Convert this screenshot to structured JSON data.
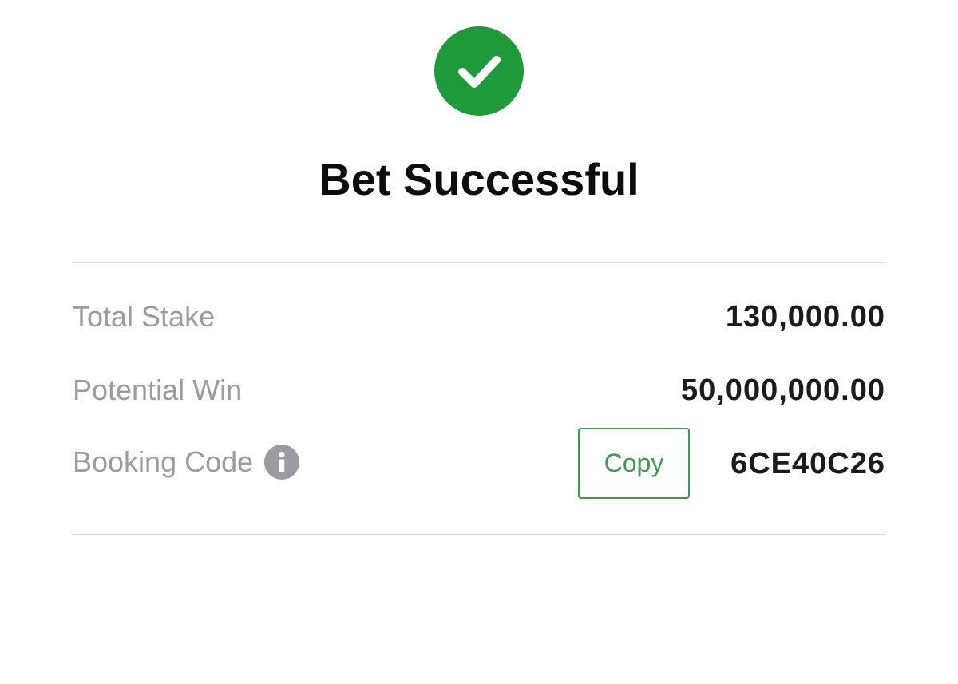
{
  "status": {
    "icon": "check-circle-icon",
    "title": "Bet Successful"
  },
  "summary": {
    "total_stake": {
      "label": "Total Stake",
      "value": "130,000.00"
    },
    "potential_win": {
      "label": "Potential Win",
      "value": "50,000,000.00"
    },
    "booking_code": {
      "label": "Booking Code",
      "info_icon": "info-icon",
      "copy_label": "Copy",
      "value": "6CE40C26"
    }
  },
  "colors": {
    "success": "#1f9a3b",
    "copy_accent": "#3d9a4e",
    "muted_text": "#9b9ba3"
  }
}
